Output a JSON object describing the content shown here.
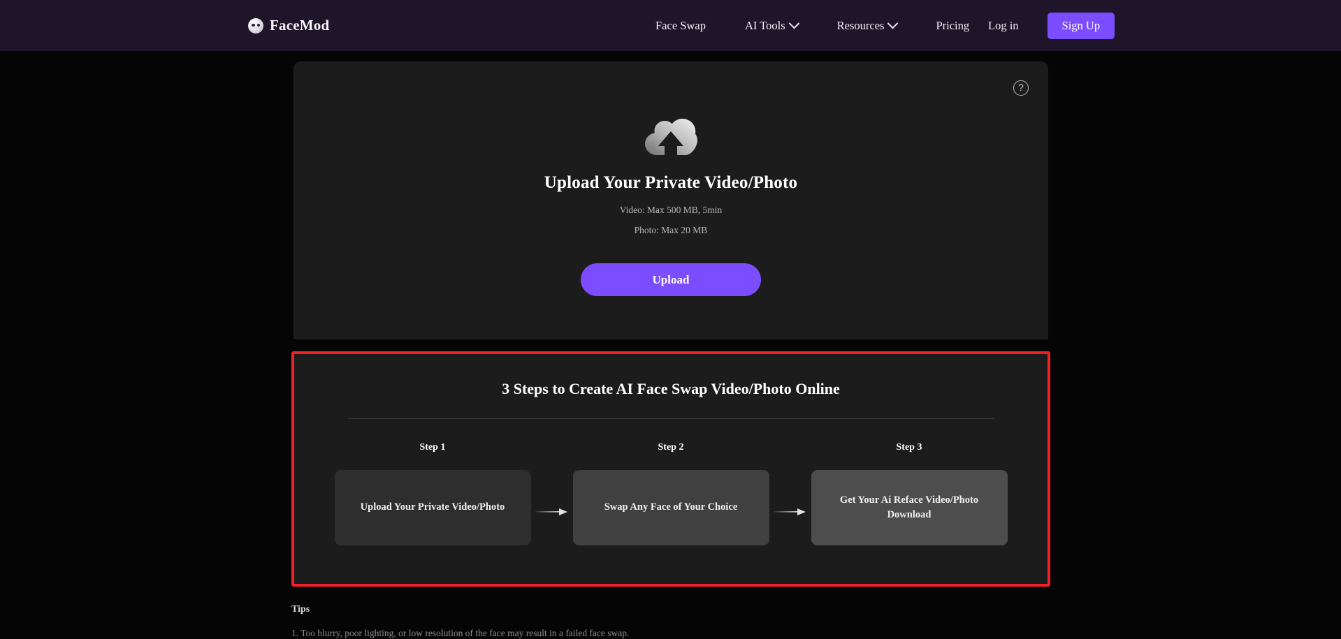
{
  "nav": {
    "brand": {
      "name": "FaceMod",
      "icon": "face-logo-icon"
    },
    "links": [
      {
        "label": "Face Swap",
        "has_caret": false
      },
      {
        "label": "AI Tools",
        "has_caret": true
      },
      {
        "label": "Resources",
        "has_caret": true
      },
      {
        "label": "Pricing",
        "has_caret": false
      }
    ],
    "login_label": "Log in",
    "signup_label": "Sign Up",
    "background_color": "#1e152a",
    "accent_color": "#7c4dff"
  },
  "upload": {
    "help_icon_glyph": "?",
    "icon": "cloud-upload-icon",
    "title": "Upload Your Private Video/Photo",
    "limit_video": "Video: Max 500 MB, 5min",
    "limit_photo": "Photo: Max 20 MB",
    "button_label": "Upload",
    "button_color": "#7c4dff",
    "card_color": "#1c1c1c"
  },
  "steps": {
    "title": "3 Steps to Create AI Face Swap Video/Photo Online",
    "highlight_border_color": "#f01f28",
    "items": [
      {
        "label": "Step 1",
        "text": "Upload Your Private Video/Photo",
        "box_color": "#2e2e2e"
      },
      {
        "label": "Step 2",
        "text": "Swap Any Face of Your Choice",
        "box_color": "#404040"
      },
      {
        "label": "Step 3",
        "text": "Get Your Ai Reface Video/Photo Download",
        "box_color": "#4d4d4d"
      }
    ],
    "connector_icon": "arrow-right-icon"
  },
  "tips": {
    "title": "Tips",
    "first_line": "1. Too blurry, poor lighting, or low resolution of the face may result in a failed face swap."
  }
}
